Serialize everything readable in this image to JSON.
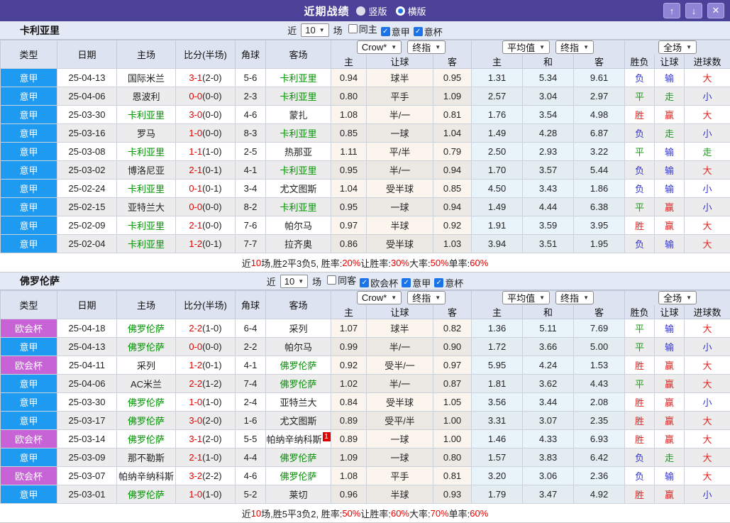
{
  "titlebar": {
    "title": "近期战绩",
    "radios": [
      {
        "label": "竖版",
        "selected": false
      },
      {
        "label": "横版",
        "selected": true
      }
    ],
    "buttons": [
      {
        "name": "up",
        "glyph": "↑"
      },
      {
        "name": "down",
        "glyph": "↓"
      },
      {
        "name": "close",
        "glyph": "✕"
      }
    ]
  },
  "colors": {
    "titlebar_bg": "#4c4199",
    "serie_a_badge": "#1e9af0",
    "conference_badge": "#c763d6",
    "focus_team_green": "#009200",
    "score_red": "#e50000",
    "win_red": "#dd2222",
    "draw_green": "#1d9a1d",
    "lose_blue": "#3333cc"
  },
  "table_header": {
    "static_cols": [
      "类型",
      "日期",
      "主场",
      "比分(半场)",
      "角球",
      "客场"
    ],
    "group1_sub": [
      "主",
      "让球",
      "客"
    ],
    "group2_sub": [
      "主",
      "和",
      "客"
    ],
    "group3_sub": [
      "胜负",
      "让球",
      "进球数"
    ]
  },
  "sections": [
    {
      "team": "卡利亚里",
      "filter": {
        "near_label": "近",
        "count": "10",
        "games_label": "场",
        "checkboxes": [
          {
            "label": "同主",
            "checked": false
          },
          {
            "label": "意甲",
            "checked": true
          },
          {
            "label": "意杯",
            "checked": true
          }
        ]
      },
      "selects": {
        "book": "Crow*",
        "book_index": "终指",
        "avg": "平均值",
        "avg_index": "终指",
        "scope": "全场"
      },
      "rows": [
        {
          "type": "意甲",
          "type_color": "blue",
          "date": "25-04-13",
          "home": "国际米兰",
          "home_focus": false,
          "score": "3-1",
          "half": "(2-0)",
          "corner": "5-6",
          "away": "卡利亚里",
          "away_focus": true,
          "badge": "",
          "odds": [
            "0.94",
            "球半",
            "0.95"
          ],
          "avg": [
            "1.31",
            "5.34",
            "9.61"
          ],
          "results": [
            {
              "t": "负",
              "c": "blue"
            },
            {
              "t": "输",
              "c": "blue"
            },
            {
              "t": "大",
              "c": "red"
            }
          ]
        },
        {
          "type": "意甲",
          "type_color": "blue",
          "date": "25-04-06",
          "home": "恩波利",
          "home_focus": false,
          "score": "0-0",
          "half": "(0-0)",
          "corner": "2-3",
          "away": "卡利亚里",
          "away_focus": true,
          "badge": "",
          "odds": [
            "0.80",
            "平手",
            "1.09"
          ],
          "avg": [
            "2.57",
            "3.04",
            "2.97"
          ],
          "results": [
            {
              "t": "平",
              "c": "green"
            },
            {
              "t": "走",
              "c": "green"
            },
            {
              "t": "小",
              "c": "blue"
            }
          ]
        },
        {
          "type": "意甲",
          "type_color": "blue",
          "date": "25-03-30",
          "home": "卡利亚里",
          "home_focus": true,
          "score": "3-0",
          "half": "(0-0)",
          "corner": "4-6",
          "away": "蒙扎",
          "away_focus": false,
          "badge": "",
          "odds": [
            "1.08",
            "半/一",
            "0.81"
          ],
          "avg": [
            "1.76",
            "3.54",
            "4.98"
          ],
          "results": [
            {
              "t": "胜",
              "c": "red"
            },
            {
              "t": "赢",
              "c": "red"
            },
            {
              "t": "大",
              "c": "red"
            }
          ]
        },
        {
          "type": "意甲",
          "type_color": "blue",
          "date": "25-03-16",
          "home": "罗马",
          "home_focus": false,
          "score": "1-0",
          "half": "(0-0)",
          "corner": "8-3",
          "away": "卡利亚里",
          "away_focus": true,
          "badge": "",
          "odds": [
            "0.85",
            "一球",
            "1.04"
          ],
          "avg": [
            "1.49",
            "4.28",
            "6.87"
          ],
          "results": [
            {
              "t": "负",
              "c": "blue"
            },
            {
              "t": "走",
              "c": "green"
            },
            {
              "t": "小",
              "c": "blue"
            }
          ]
        },
        {
          "type": "意甲",
          "type_color": "blue",
          "date": "25-03-08",
          "home": "卡利亚里",
          "home_focus": true,
          "score": "1-1",
          "half": "(1-0)",
          "corner": "2-5",
          "away": "热那亚",
          "away_focus": false,
          "badge": "",
          "odds": [
            "1.11",
            "平/半",
            "0.79"
          ],
          "avg": [
            "2.50",
            "2.93",
            "3.22"
          ],
          "results": [
            {
              "t": "平",
              "c": "green"
            },
            {
              "t": "输",
              "c": "blue"
            },
            {
              "t": "走",
              "c": "green"
            }
          ]
        },
        {
          "type": "意甲",
          "type_color": "blue",
          "date": "25-03-02",
          "home": "博洛尼亚",
          "home_focus": false,
          "score": "2-1",
          "half": "(0-1)",
          "corner": "4-1",
          "away": "卡利亚里",
          "away_focus": true,
          "badge": "",
          "odds": [
            "0.95",
            "半/一",
            "0.94"
          ],
          "avg": [
            "1.70",
            "3.57",
            "5.44"
          ],
          "results": [
            {
              "t": "负",
              "c": "blue"
            },
            {
              "t": "输",
              "c": "blue"
            },
            {
              "t": "大",
              "c": "red"
            }
          ]
        },
        {
          "type": "意甲",
          "type_color": "blue",
          "date": "25-02-24",
          "home": "卡利亚里",
          "home_focus": true,
          "score": "0-1",
          "half": "(0-1)",
          "corner": "3-4",
          "away": "尤文图斯",
          "away_focus": false,
          "badge": "",
          "odds": [
            "1.04",
            "受半球",
            "0.85"
          ],
          "avg": [
            "4.50",
            "3.43",
            "1.86"
          ],
          "results": [
            {
              "t": "负",
              "c": "blue"
            },
            {
              "t": "输",
              "c": "blue"
            },
            {
              "t": "小",
              "c": "blue"
            }
          ]
        },
        {
          "type": "意甲",
          "type_color": "blue",
          "date": "25-02-15",
          "home": "亚特兰大",
          "home_focus": false,
          "score": "0-0",
          "half": "(0-0)",
          "corner": "8-2",
          "away": "卡利亚里",
          "away_focus": true,
          "badge": "",
          "odds": [
            "0.95",
            "一球",
            "0.94"
          ],
          "avg": [
            "1.49",
            "4.44",
            "6.38"
          ],
          "results": [
            {
              "t": "平",
              "c": "green"
            },
            {
              "t": "赢",
              "c": "red"
            },
            {
              "t": "小",
              "c": "blue"
            }
          ]
        },
        {
          "type": "意甲",
          "type_color": "blue",
          "date": "25-02-09",
          "home": "卡利亚里",
          "home_focus": true,
          "score": "2-1",
          "half": "(0-0)",
          "corner": "7-6",
          "away": "帕尔马",
          "away_focus": false,
          "badge": "",
          "odds": [
            "0.97",
            "半球",
            "0.92"
          ],
          "avg": [
            "1.91",
            "3.59",
            "3.95"
          ],
          "results": [
            {
              "t": "胜",
              "c": "red"
            },
            {
              "t": "赢",
              "c": "red"
            },
            {
              "t": "大",
              "c": "red"
            }
          ]
        },
        {
          "type": "意甲",
          "type_color": "blue",
          "date": "25-02-04",
          "home": "卡利亚里",
          "home_focus": true,
          "score": "1-2",
          "half": "(0-1)",
          "corner": "7-7",
          "away": "拉齐奥",
          "away_focus": false,
          "badge": "",
          "odds": [
            "0.86",
            "受半球",
            "1.03"
          ],
          "avg": [
            "3.94",
            "3.51",
            "1.95"
          ],
          "results": [
            {
              "t": "负",
              "c": "blue"
            },
            {
              "t": "输",
              "c": "blue"
            },
            {
              "t": "大",
              "c": "red"
            }
          ]
        }
      ],
      "summary": [
        {
          "t": "近",
          "red": false
        },
        {
          "t": "10",
          "red": true
        },
        {
          "t": "场,胜2平3负5, 胜率:",
          "red": false
        },
        {
          "t": "20%",
          "red": true
        },
        {
          "t": " 让胜率:",
          "red": false
        },
        {
          "t": "30%",
          "red": true
        },
        {
          "t": " 大率:",
          "red": false
        },
        {
          "t": "50%",
          "red": true
        },
        {
          "t": " 单率:",
          "red": false
        },
        {
          "t": "60%",
          "red": true
        }
      ]
    },
    {
      "team": "佛罗伦萨",
      "filter": {
        "near_label": "近",
        "count": "10",
        "games_label": "场",
        "checkboxes": [
          {
            "label": "同客",
            "checked": false
          },
          {
            "label": "欧会杯",
            "checked": true
          },
          {
            "label": "意甲",
            "checked": true
          },
          {
            "label": "意杯",
            "checked": true
          }
        ]
      },
      "selects": {
        "book": "Crow*",
        "book_index": "终指",
        "avg": "平均值",
        "avg_index": "终指",
        "scope": "全场"
      },
      "rows": [
        {
          "type": "欧会杯",
          "type_color": "purple",
          "date": "25-04-18",
          "home": "佛罗伦萨",
          "home_focus": true,
          "score": "2-2",
          "half": "(1-0)",
          "corner": "6-4",
          "away": "采列",
          "away_focus": false,
          "badge": "",
          "odds": [
            "1.07",
            "球半",
            "0.82"
          ],
          "avg": [
            "1.36",
            "5.11",
            "7.69"
          ],
          "results": [
            {
              "t": "平",
              "c": "green"
            },
            {
              "t": "输",
              "c": "blue"
            },
            {
              "t": "大",
              "c": "red"
            }
          ]
        },
        {
          "type": "意甲",
          "type_color": "blue",
          "date": "25-04-13",
          "home": "佛罗伦萨",
          "home_focus": true,
          "score": "0-0",
          "half": "(0-0)",
          "corner": "2-2",
          "away": "帕尔马",
          "away_focus": false,
          "badge": "",
          "odds": [
            "0.99",
            "半/一",
            "0.90"
          ],
          "avg": [
            "1.72",
            "3.66",
            "5.00"
          ],
          "results": [
            {
              "t": "平",
              "c": "green"
            },
            {
              "t": "输",
              "c": "blue"
            },
            {
              "t": "小",
              "c": "blue"
            }
          ]
        },
        {
          "type": "欧会杯",
          "type_color": "purple",
          "date": "25-04-11",
          "home": "采列",
          "home_focus": false,
          "score": "1-2",
          "half": "(0-1)",
          "corner": "4-1",
          "away": "佛罗伦萨",
          "away_focus": true,
          "badge": "",
          "odds": [
            "0.92",
            "受半/一",
            "0.97"
          ],
          "avg": [
            "5.95",
            "4.24",
            "1.53"
          ],
          "results": [
            {
              "t": "胜",
              "c": "red"
            },
            {
              "t": "赢",
              "c": "red"
            },
            {
              "t": "大",
              "c": "red"
            }
          ]
        },
        {
          "type": "意甲",
          "type_color": "blue",
          "date": "25-04-06",
          "home": "AC米兰",
          "home_focus": false,
          "score": "2-2",
          "half": "(1-2)",
          "corner": "7-4",
          "away": "佛罗伦萨",
          "away_focus": true,
          "badge": "",
          "odds": [
            "1.02",
            "半/一",
            "0.87"
          ],
          "avg": [
            "1.81",
            "3.62",
            "4.43"
          ],
          "results": [
            {
              "t": "平",
              "c": "green"
            },
            {
              "t": "赢",
              "c": "red"
            },
            {
              "t": "大",
              "c": "red"
            }
          ]
        },
        {
          "type": "意甲",
          "type_color": "blue",
          "date": "25-03-30",
          "home": "佛罗伦萨",
          "home_focus": true,
          "score": "1-0",
          "half": "(1-0)",
          "corner": "2-4",
          "away": "亚特兰大",
          "away_focus": false,
          "badge": "",
          "odds": [
            "0.84",
            "受半球",
            "1.05"
          ],
          "avg": [
            "3.56",
            "3.44",
            "2.08"
          ],
          "results": [
            {
              "t": "胜",
              "c": "red"
            },
            {
              "t": "赢",
              "c": "red"
            },
            {
              "t": "小",
              "c": "blue"
            }
          ]
        },
        {
          "type": "意甲",
          "type_color": "blue",
          "date": "25-03-17",
          "home": "佛罗伦萨",
          "home_focus": true,
          "score": "3-0",
          "half": "(2-0)",
          "corner": "1-6",
          "away": "尤文图斯",
          "away_focus": false,
          "badge": "",
          "odds": [
            "0.89",
            "受平/半",
            "1.00"
          ],
          "avg": [
            "3.31",
            "3.07",
            "2.35"
          ],
          "results": [
            {
              "t": "胜",
              "c": "red"
            },
            {
              "t": "赢",
              "c": "red"
            },
            {
              "t": "大",
              "c": "red"
            }
          ]
        },
        {
          "type": "欧会杯",
          "type_color": "purple",
          "date": "25-03-14",
          "home": "佛罗伦萨",
          "home_focus": true,
          "score": "3-1",
          "half": "(2-0)",
          "corner": "5-5",
          "away": "帕纳辛纳科斯",
          "away_focus": false,
          "badge": "1",
          "odds": [
            "0.89",
            "一球",
            "1.00"
          ],
          "avg": [
            "1.46",
            "4.33",
            "6.93"
          ],
          "results": [
            {
              "t": "胜",
              "c": "red"
            },
            {
              "t": "赢",
              "c": "red"
            },
            {
              "t": "大",
              "c": "red"
            }
          ]
        },
        {
          "type": "意甲",
          "type_color": "blue",
          "date": "25-03-09",
          "home": "那不勒斯",
          "home_focus": false,
          "score": "2-1",
          "half": "(1-0)",
          "corner": "4-4",
          "away": "佛罗伦萨",
          "away_focus": true,
          "badge": "",
          "odds": [
            "1.09",
            "一球",
            "0.80"
          ],
          "avg": [
            "1.57",
            "3.83",
            "6.42"
          ],
          "results": [
            {
              "t": "负",
              "c": "blue"
            },
            {
              "t": "走",
              "c": "green"
            },
            {
              "t": "大",
              "c": "red"
            }
          ]
        },
        {
          "type": "欧会杯",
          "type_color": "purple",
          "date": "25-03-07",
          "home": "帕纳辛纳科斯",
          "home_focus": false,
          "score": "3-2",
          "half": "(2-2)",
          "corner": "4-6",
          "away": "佛罗伦萨",
          "away_focus": true,
          "badge": "",
          "odds": [
            "1.08",
            "平手",
            "0.81"
          ],
          "avg": [
            "3.20",
            "3.06",
            "2.36"
          ],
          "results": [
            {
              "t": "负",
              "c": "blue"
            },
            {
              "t": "输",
              "c": "blue"
            },
            {
              "t": "大",
              "c": "red"
            }
          ]
        },
        {
          "type": "意甲",
          "type_color": "blue",
          "date": "25-03-01",
          "home": "佛罗伦萨",
          "home_focus": true,
          "score": "1-0",
          "half": "(1-0)",
          "corner": "5-2",
          "away": "莱切",
          "away_focus": false,
          "badge": "",
          "odds": [
            "0.96",
            "半球",
            "0.93"
          ],
          "avg": [
            "1.79",
            "3.47",
            "4.92"
          ],
          "results": [
            {
              "t": "胜",
              "c": "red"
            },
            {
              "t": "赢",
              "c": "red"
            },
            {
              "t": "小",
              "c": "blue"
            }
          ]
        }
      ],
      "summary": [
        {
          "t": "近",
          "red": false
        },
        {
          "t": "10",
          "red": true
        },
        {
          "t": "场,胜5平3负2, 胜率:",
          "red": false
        },
        {
          "t": "50%",
          "red": true
        },
        {
          "t": " 让胜率:",
          "red": false
        },
        {
          "t": "60%",
          "red": true
        },
        {
          "t": " 大率:",
          "red": false
        },
        {
          "t": "70%",
          "red": true
        },
        {
          "t": " 单率:",
          "red": false
        },
        {
          "t": "60%",
          "red": true
        }
      ]
    }
  ]
}
